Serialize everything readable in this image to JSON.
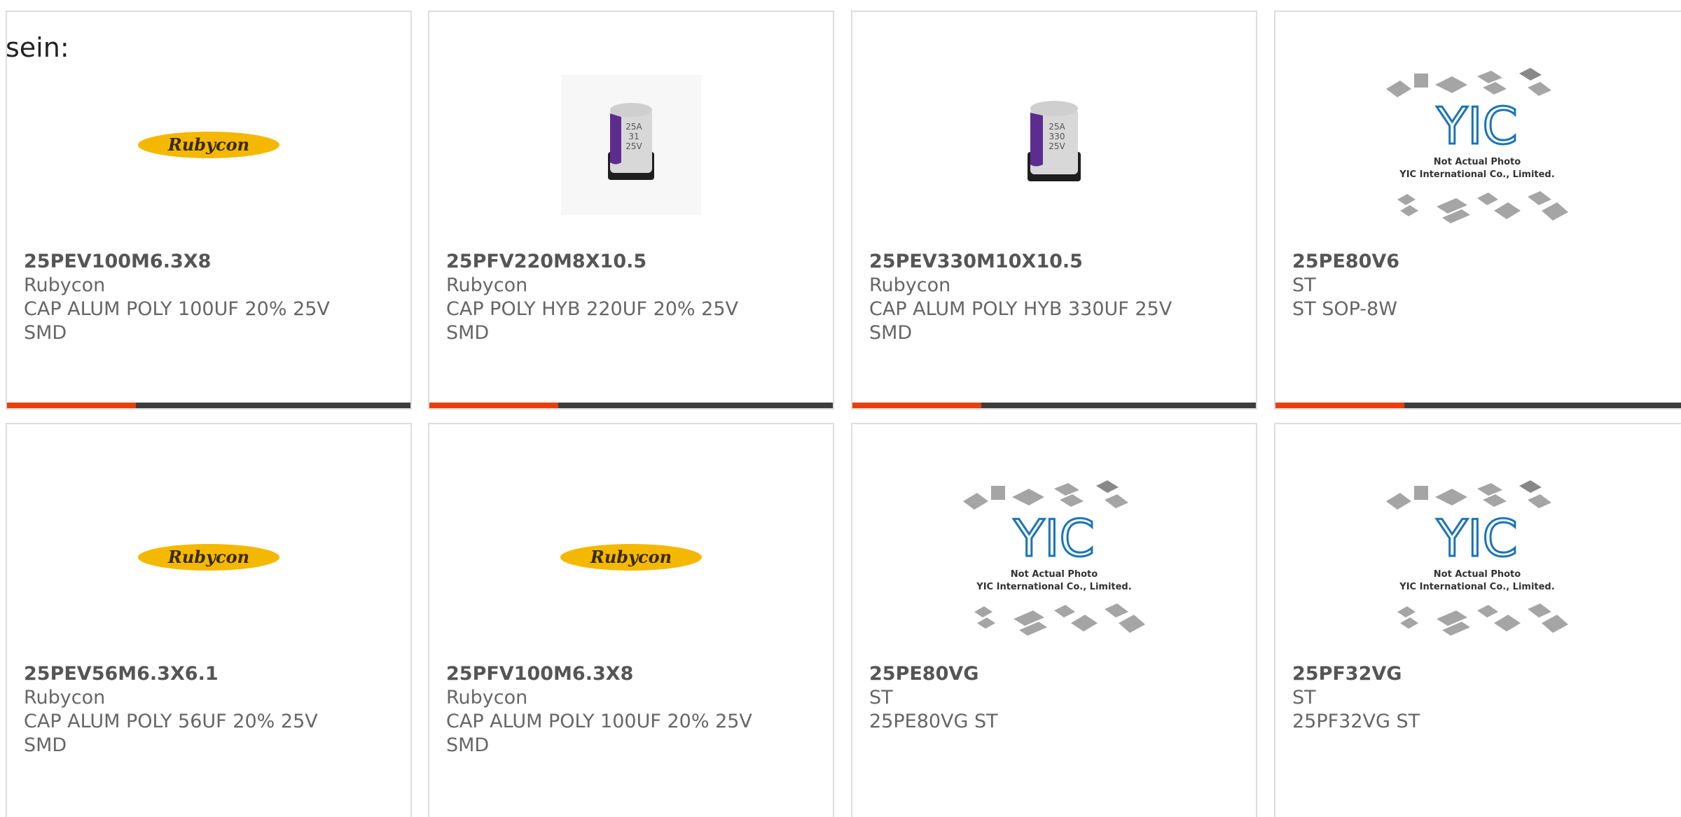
{
  "intro_text": "sein:",
  "colors": {
    "accent": "#e8400c",
    "bar": "#3d3d3d",
    "rubycon_yellow": "#f5b800",
    "yic_blue": "#1a73b8"
  },
  "cards": [
    {
      "part": "25PEV100M6.3X8",
      "maker": "Rubycon",
      "desc1": "CAP ALUM POLY 100UF 20% 25V",
      "desc2": "SMD",
      "image": "rubycon-logo"
    },
    {
      "part": "25PFV220M8X10.5",
      "maker": "Rubycon",
      "desc1": "CAP POLY HYB 220UF 20% 25V",
      "desc2": "SMD",
      "image": "capacitor-photo",
      "cap_marking": [
        "25A",
        "31",
        "25V"
      ]
    },
    {
      "part": "25PEV330M10X10.5",
      "maker": "Rubycon",
      "desc1": "CAP ALUM POLY HYB 330UF 25V",
      "desc2": "SMD",
      "image": "capacitor-photo",
      "cap_marking": [
        "25A",
        "330",
        "25V"
      ]
    },
    {
      "part": "25PE80V6",
      "maker": "ST",
      "desc1": "ST SOP-8W",
      "desc2": "",
      "image": "yic-placeholder",
      "photo_caption": "Not Actual Photo",
      "photo_company": "YIC International Co., Limited.",
      "photo_logo": "YIC"
    },
    {
      "part": "25PEV56M6.3X6.1",
      "maker": "Rubycon",
      "desc1": "CAP ALUM POLY 56UF 20% 25V",
      "desc2": "SMD",
      "image": "rubycon-logo"
    },
    {
      "part": "25PFV100M6.3X8",
      "maker": "Rubycon",
      "desc1": "CAP ALUM POLY 100UF 20% 25V",
      "desc2": "SMD",
      "image": "rubycon-logo"
    },
    {
      "part": "25PE80VG",
      "maker": "ST",
      "desc1": "25PE80VG ST",
      "desc2": "",
      "image": "yic-placeholder",
      "photo_caption": "Not Actual Photo",
      "photo_company": "YIC International Co., Limited.",
      "photo_logo": "YIC"
    },
    {
      "part": "25PF32VG",
      "maker": "ST",
      "desc1": "25PF32VG ST",
      "desc2": "",
      "image": "yic-placeholder",
      "photo_caption": "Not Actual Photo",
      "photo_company": "YIC International Co., Limited.",
      "photo_logo": "YIC"
    }
  ],
  "rubycon_logo_text": "Rubycon"
}
